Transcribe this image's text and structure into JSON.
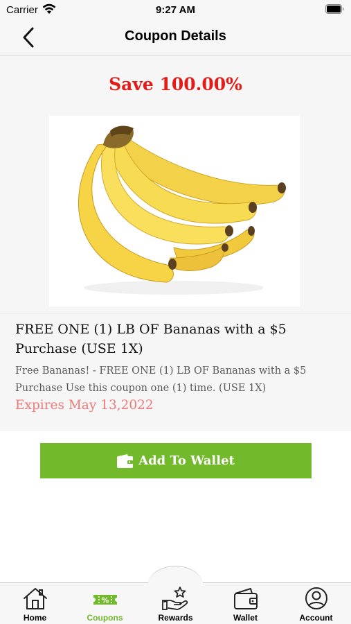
{
  "status_bar": {
    "carrier": "Carrier",
    "time": "9:27 AM"
  },
  "nav": {
    "title": "Coupon Details",
    "back_icon": "chevron-left-icon"
  },
  "coupon": {
    "savings": "Save 100.00%",
    "image": "bananas-photo",
    "title": "FREE ONE (1) LB OF Bananas with a $5 Purchase (USE 1X)",
    "description": "Free Bananas! - FREE ONE (1) LB OF Bananas with a $5 Purchase Use this coupon one (1) time. (USE 1X)",
    "expires": "Expires May 13,2022"
  },
  "actions": {
    "add_to_wallet_label": "Add To Wallet",
    "add_to_wallet_icon": "wallet-icon"
  },
  "tabs": [
    {
      "label": "Home",
      "icon": "home-icon",
      "active": false
    },
    {
      "label": "Coupons",
      "icon": "coupon-ticket-icon",
      "active": true
    },
    {
      "label": "Rewards",
      "icon": "rewards-hand-star-icon",
      "active": false
    },
    {
      "label": "Wallet",
      "icon": "wallet-icon",
      "active": false
    },
    {
      "label": "Account",
      "icon": "account-icon",
      "active": false
    }
  ],
  "colors": {
    "accent_green": "#72b92b",
    "save_red": "#e41b17",
    "expires_pink": "#ef7a78",
    "background": "#f6f6f6"
  }
}
